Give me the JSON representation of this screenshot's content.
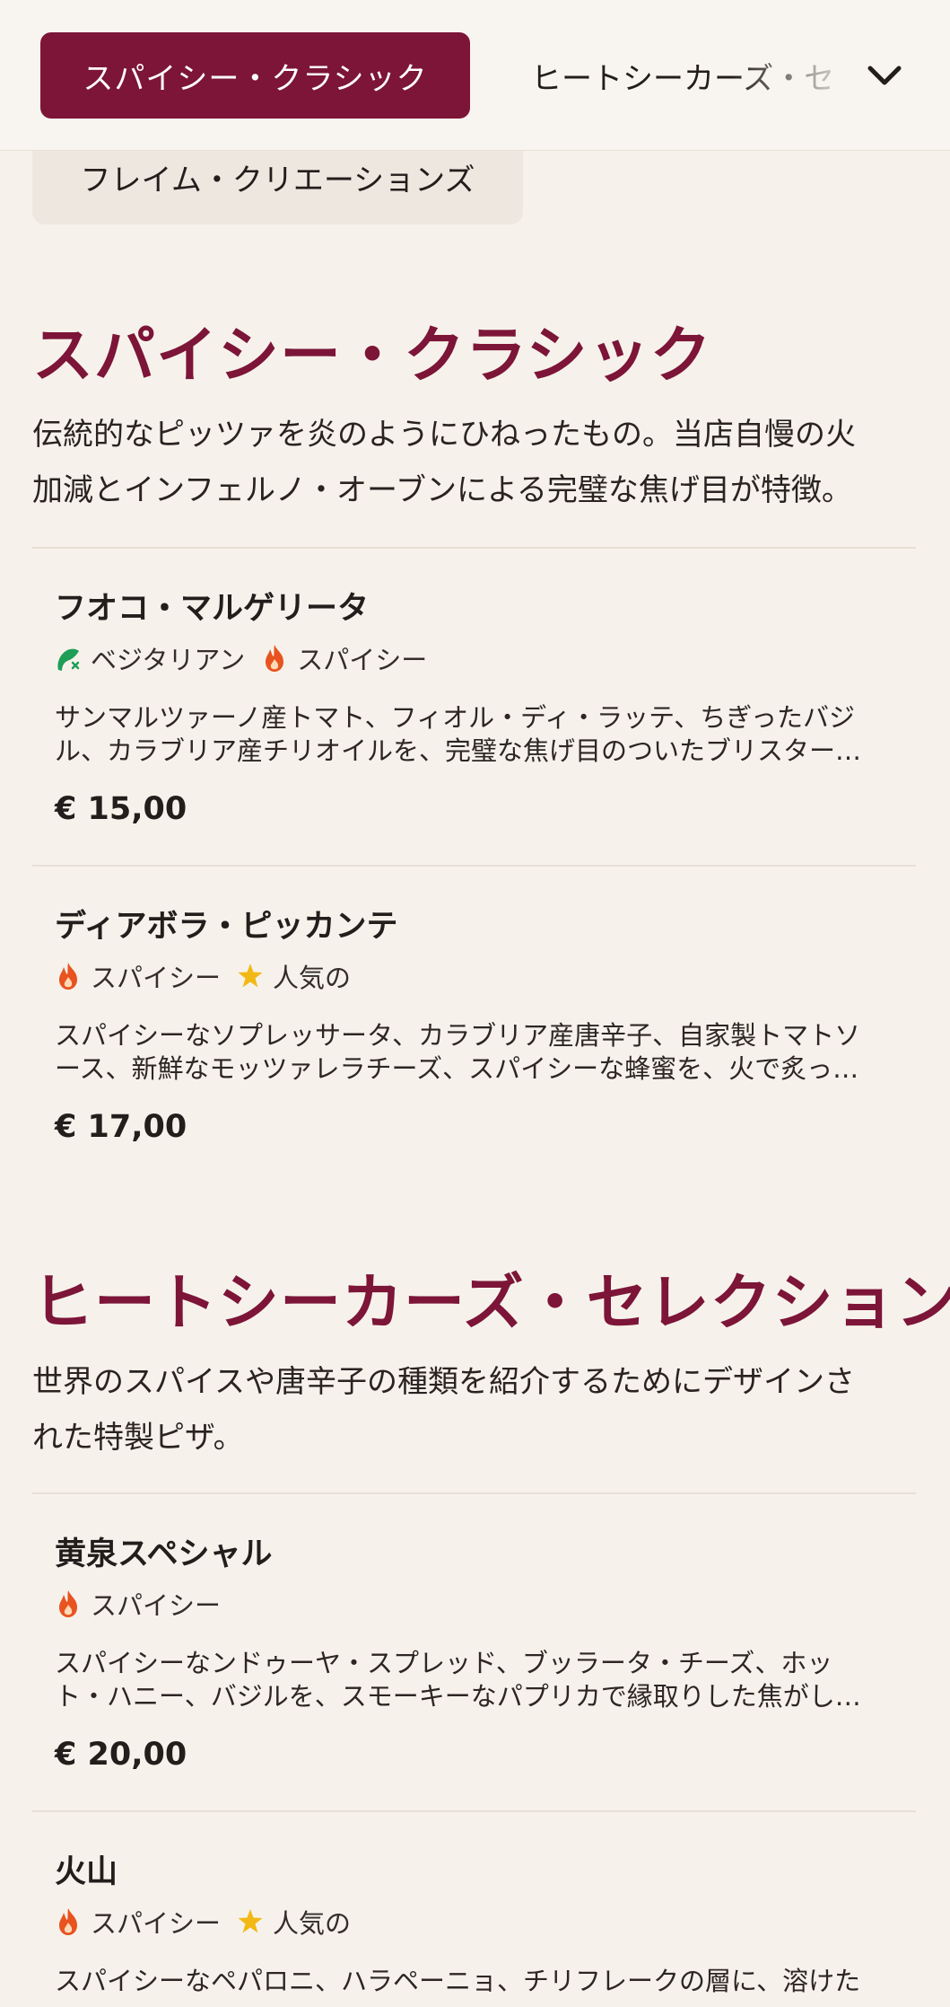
{
  "nav": {
    "active_category": "スパイシー・クラシック",
    "next_category": "ヒートシーカーズ・セ",
    "second_row_category": "フレイム・クリエーションズ",
    "expand_icon": "chevron-down-icon"
  },
  "colors": {
    "brand": "#7c1538",
    "background": "#f6f2eb",
    "veg_green": "#1e9e57",
    "spicy_orange": "#e8531f",
    "popular_gold": "#f2b916"
  },
  "sections": [
    {
      "title": "スパイシー・クラシック",
      "description_lines": [
        "伝統的なピッツァを炎のようにひねったもの。当店自慢の火",
        "加減とインフェルノ・オーブンによる完璧な焦げ目が特徴。"
      ],
      "items": [
        {
          "name": "フオコ・マルゲリータ",
          "tags": [
            {
              "icon": "vegetarian-icon",
              "label": "ベジタリアン"
            },
            {
              "icon": "flame-icon",
              "label": "スパイシー"
            }
          ],
          "description_lines": [
            "サンマルツァーノ産トマト、フィオル・ディ・ラッテ、ちぎったバジ",
            "ル、カラブリア産チリオイルを、完璧な焦げ目のついたブリスター…"
          ],
          "price": "€ 15,00"
        },
        {
          "name": "ディアボラ・ピッカンテ",
          "tags": [
            {
              "icon": "flame-icon",
              "label": "スパイシー"
            },
            {
              "icon": "star-icon",
              "label": "人気の"
            }
          ],
          "description_lines": [
            "スパイシーなソプレッサータ、カラブリア産唐辛子、自家製トマトソ",
            "ース、新鮮なモッツァレラチーズ、スパイシーな蜂蜜を、火で炙っ…"
          ],
          "price": "€ 17,00"
        }
      ]
    },
    {
      "title": "ヒートシーカーズ・セレクション",
      "description_lines": [
        "世界のスパイスや唐辛子の種類を紹介するためにデザインさ",
        "れた特製ピザ。"
      ],
      "items": [
        {
          "name": "黄泉スペシャル",
          "tags": [
            {
              "icon": "flame-icon",
              "label": "スパイシー"
            }
          ],
          "description_lines": [
            "スパイシーなンドゥーヤ・スプレッド、ブッラータ・チーズ、ホッ",
            "ト・ハニー、バジルを、スモーキーなパプリカで縁取りした焦がし…"
          ],
          "price": "€ 20,00"
        },
        {
          "name": "火山",
          "tags": [
            {
              "icon": "flame-icon",
              "label": "スパイシー"
            },
            {
              "icon": "star-icon",
              "label": "人気の"
            }
          ],
          "description_lines": [
            "スパイシーなペパロニ、ハラペーニョ、チリフレークの層に、溶けた",
            ""
          ],
          "price": ""
        }
      ]
    }
  ]
}
